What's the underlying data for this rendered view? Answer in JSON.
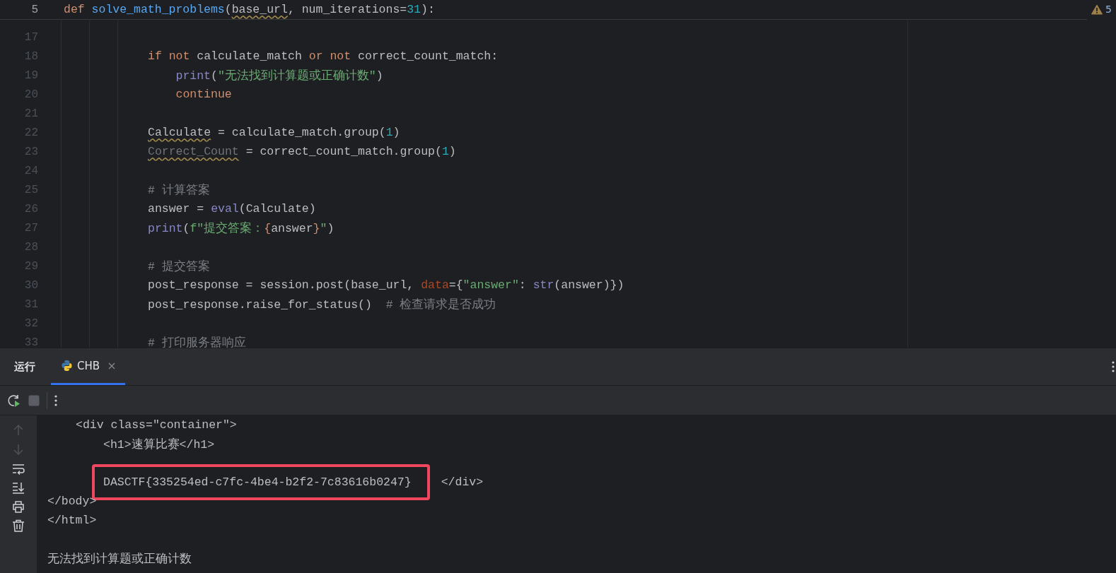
{
  "editor": {
    "problems": {
      "count": "5"
    },
    "sticky_line": {
      "number": "5",
      "tokens": [
        {
          "text": "def ",
          "kind": "keyword"
        },
        {
          "text": "solve_math_problems",
          "kind": "function"
        },
        {
          "text": "(",
          "kind": "plain"
        },
        {
          "text": "base_url",
          "kind": "warn"
        },
        {
          "text": ", num_iterations=",
          "kind": "plain"
        },
        {
          "text": "31",
          "kind": "number"
        },
        {
          "text": "):",
          "kind": "plain"
        }
      ]
    },
    "lines": [
      {
        "number": "17"
      },
      {
        "number": "18",
        "tokens": [
          {
            "text": "if not ",
            "kind": "keyword"
          },
          {
            "text": "calculate_match ",
            "kind": "plain"
          },
          {
            "text": "or not ",
            "kind": "keyword"
          },
          {
            "text": "correct_count_match:",
            "kind": "plain"
          }
        ],
        "children": [
          {
            "number": "19",
            "tokens": [
              {
                "text": "print",
                "kind": "builtin"
              },
              {
                "text": "(",
                "kind": "plain"
              },
              {
                "text": "\"无法找到计算题或正确计数\"",
                "kind": "string"
              },
              {
                "text": ")",
                "kind": "plain"
              }
            ]
          },
          {
            "number": "20",
            "tokens": [
              {
                "text": "continue",
                "kind": "keyword"
              }
            ]
          }
        ]
      },
      {
        "number": "21"
      },
      {
        "number": "22",
        "tokens": [
          {
            "text": "Calculate",
            "kind": "warn"
          },
          {
            "text": " = calculate_match.group(",
            "kind": "plain"
          },
          {
            "text": "1",
            "kind": "number"
          },
          {
            "text": ")",
            "kind": "plain"
          }
        ]
      },
      {
        "number": "23",
        "tokens": [
          {
            "text": "Correct_Count",
            "kind": "unused"
          },
          {
            "text": " = correct_count_match.group(",
            "kind": "plain"
          },
          {
            "text": "1",
            "kind": "number"
          },
          {
            "text": ")",
            "kind": "plain"
          }
        ]
      },
      {
        "number": "24"
      },
      {
        "number": "25",
        "tokens": [
          {
            "text": "# 计算答案",
            "kind": "comment"
          }
        ]
      },
      {
        "number": "26",
        "tokens": [
          {
            "text": "answer = ",
            "kind": "plain"
          },
          {
            "text": "eval",
            "kind": "builtin"
          },
          {
            "text": "(Calculate)",
            "kind": "plain"
          }
        ]
      },
      {
        "number": "27",
        "tokens": [
          {
            "text": "print",
            "kind": "builtin"
          },
          {
            "text": "(",
            "kind": "plain"
          },
          {
            "text": "f\"提交答案：",
            "kind": "string"
          },
          {
            "text": "{",
            "kind": "brace"
          },
          {
            "text": "answer",
            "kind": "plain"
          },
          {
            "text": "}",
            "kind": "brace"
          },
          {
            "text": "\"",
            "kind": "string"
          },
          {
            "text": ")",
            "kind": "plain"
          }
        ]
      },
      {
        "number": "28"
      },
      {
        "number": "29",
        "tokens": [
          {
            "text": "# 提交答案",
            "kind": "comment"
          }
        ]
      },
      {
        "number": "30",
        "tokens": [
          {
            "text": "post_response = session.post(base_url, ",
            "kind": "plain"
          },
          {
            "text": "data",
            "kind": "kwarg"
          },
          {
            "text": "={",
            "kind": "plain"
          },
          {
            "text": "\"answer\"",
            "kind": "string"
          },
          {
            "text": ": ",
            "kind": "plain"
          },
          {
            "text": "str",
            "kind": "builtin"
          },
          {
            "text": "(answer)})",
            "kind": "plain"
          }
        ]
      },
      {
        "number": "31",
        "tokens": [
          {
            "text": "post_response.raise_for_status()  ",
            "kind": "plain"
          },
          {
            "text": "# 检查请求是否成功",
            "kind": "comment"
          }
        ]
      },
      {
        "number": "32"
      },
      {
        "number": "33",
        "tokens": [
          {
            "text": "# 打印服务器响应",
            "kind": "comment"
          }
        ]
      }
    ]
  },
  "run_panel": {
    "title": "运行",
    "tabs": [
      {
        "label": "CHB",
        "selected": true
      }
    ]
  },
  "console": {
    "lines": [
      {
        "children": [
          {
            "segments": [
              {
                "text": "<div class=\"container\">",
                "highlighted": false
              }
            ],
            "children": [
              {
                "segments": [
                  {
                    "text": "<h1>速算比赛</h1>",
                    "highlighted": false
                  }
                ]
              },
              {
                "blank_before": true,
                "segments": [
                  {
                    "text": "DASCTF{335254ed-c7fc-4be4-b2f2-7c83616b0247}",
                    "highlighted": true
                  },
                  {
                    "text": "</div>",
                    "highlighted": false
                  }
                ]
              }
            ]
          }
        ]
      },
      {
        "segments": [
          {
            "text": "</body>",
            "highlighted": false
          }
        ]
      },
      {
        "segments": [
          {
            "text": "</html>",
            "highlighted": false
          }
        ]
      },
      {
        "blank_before": true,
        "segments": [
          {
            "text": "无法找到计算题或正确计数",
            "highlighted": false
          }
        ]
      }
    ]
  }
}
